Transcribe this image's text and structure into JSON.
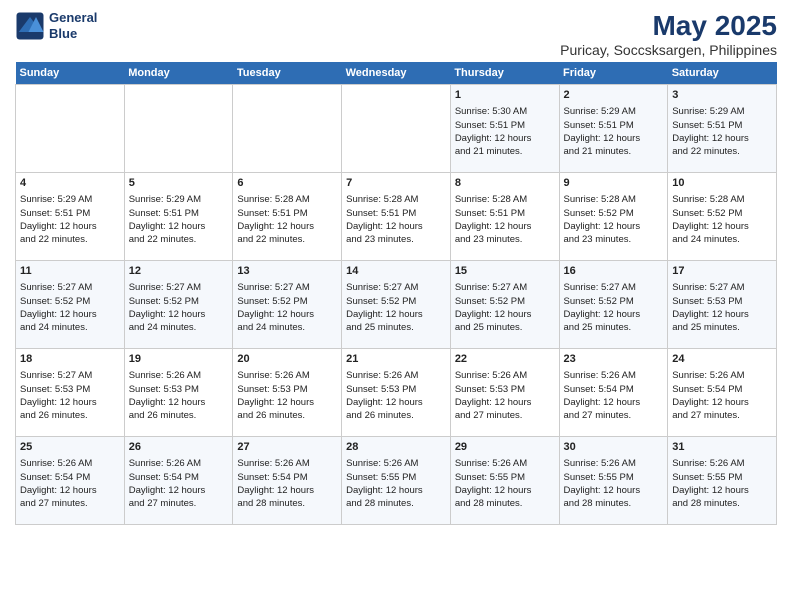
{
  "header": {
    "logo_line1": "General",
    "logo_line2": "Blue",
    "title": "May 2025",
    "subtitle": "Puricay, Soccsksargen, Philippines"
  },
  "days_of_week": [
    "Sunday",
    "Monday",
    "Tuesday",
    "Wednesday",
    "Thursday",
    "Friday",
    "Saturday"
  ],
  "weeks": [
    [
      {
        "day": "",
        "info": ""
      },
      {
        "day": "",
        "info": ""
      },
      {
        "day": "",
        "info": ""
      },
      {
        "day": "",
        "info": ""
      },
      {
        "day": "1",
        "info": "Sunrise: 5:30 AM\nSunset: 5:51 PM\nDaylight: 12 hours\nand 21 minutes."
      },
      {
        "day": "2",
        "info": "Sunrise: 5:29 AM\nSunset: 5:51 PM\nDaylight: 12 hours\nand 21 minutes."
      },
      {
        "day": "3",
        "info": "Sunrise: 5:29 AM\nSunset: 5:51 PM\nDaylight: 12 hours\nand 22 minutes."
      }
    ],
    [
      {
        "day": "4",
        "info": "Sunrise: 5:29 AM\nSunset: 5:51 PM\nDaylight: 12 hours\nand 22 minutes."
      },
      {
        "day": "5",
        "info": "Sunrise: 5:29 AM\nSunset: 5:51 PM\nDaylight: 12 hours\nand 22 minutes."
      },
      {
        "day": "6",
        "info": "Sunrise: 5:28 AM\nSunset: 5:51 PM\nDaylight: 12 hours\nand 22 minutes."
      },
      {
        "day": "7",
        "info": "Sunrise: 5:28 AM\nSunset: 5:51 PM\nDaylight: 12 hours\nand 23 minutes."
      },
      {
        "day": "8",
        "info": "Sunrise: 5:28 AM\nSunset: 5:51 PM\nDaylight: 12 hours\nand 23 minutes."
      },
      {
        "day": "9",
        "info": "Sunrise: 5:28 AM\nSunset: 5:52 PM\nDaylight: 12 hours\nand 23 minutes."
      },
      {
        "day": "10",
        "info": "Sunrise: 5:28 AM\nSunset: 5:52 PM\nDaylight: 12 hours\nand 24 minutes."
      }
    ],
    [
      {
        "day": "11",
        "info": "Sunrise: 5:27 AM\nSunset: 5:52 PM\nDaylight: 12 hours\nand 24 minutes."
      },
      {
        "day": "12",
        "info": "Sunrise: 5:27 AM\nSunset: 5:52 PM\nDaylight: 12 hours\nand 24 minutes."
      },
      {
        "day": "13",
        "info": "Sunrise: 5:27 AM\nSunset: 5:52 PM\nDaylight: 12 hours\nand 24 minutes."
      },
      {
        "day": "14",
        "info": "Sunrise: 5:27 AM\nSunset: 5:52 PM\nDaylight: 12 hours\nand 25 minutes."
      },
      {
        "day": "15",
        "info": "Sunrise: 5:27 AM\nSunset: 5:52 PM\nDaylight: 12 hours\nand 25 minutes."
      },
      {
        "day": "16",
        "info": "Sunrise: 5:27 AM\nSunset: 5:52 PM\nDaylight: 12 hours\nand 25 minutes."
      },
      {
        "day": "17",
        "info": "Sunrise: 5:27 AM\nSunset: 5:53 PM\nDaylight: 12 hours\nand 25 minutes."
      }
    ],
    [
      {
        "day": "18",
        "info": "Sunrise: 5:27 AM\nSunset: 5:53 PM\nDaylight: 12 hours\nand 26 minutes."
      },
      {
        "day": "19",
        "info": "Sunrise: 5:26 AM\nSunset: 5:53 PM\nDaylight: 12 hours\nand 26 minutes."
      },
      {
        "day": "20",
        "info": "Sunrise: 5:26 AM\nSunset: 5:53 PM\nDaylight: 12 hours\nand 26 minutes."
      },
      {
        "day": "21",
        "info": "Sunrise: 5:26 AM\nSunset: 5:53 PM\nDaylight: 12 hours\nand 26 minutes."
      },
      {
        "day": "22",
        "info": "Sunrise: 5:26 AM\nSunset: 5:53 PM\nDaylight: 12 hours\nand 27 minutes."
      },
      {
        "day": "23",
        "info": "Sunrise: 5:26 AM\nSunset: 5:54 PM\nDaylight: 12 hours\nand 27 minutes."
      },
      {
        "day": "24",
        "info": "Sunrise: 5:26 AM\nSunset: 5:54 PM\nDaylight: 12 hours\nand 27 minutes."
      }
    ],
    [
      {
        "day": "25",
        "info": "Sunrise: 5:26 AM\nSunset: 5:54 PM\nDaylight: 12 hours\nand 27 minutes."
      },
      {
        "day": "26",
        "info": "Sunrise: 5:26 AM\nSunset: 5:54 PM\nDaylight: 12 hours\nand 27 minutes."
      },
      {
        "day": "27",
        "info": "Sunrise: 5:26 AM\nSunset: 5:54 PM\nDaylight: 12 hours\nand 28 minutes."
      },
      {
        "day": "28",
        "info": "Sunrise: 5:26 AM\nSunset: 5:55 PM\nDaylight: 12 hours\nand 28 minutes."
      },
      {
        "day": "29",
        "info": "Sunrise: 5:26 AM\nSunset: 5:55 PM\nDaylight: 12 hours\nand 28 minutes."
      },
      {
        "day": "30",
        "info": "Sunrise: 5:26 AM\nSunset: 5:55 PM\nDaylight: 12 hours\nand 28 minutes."
      },
      {
        "day": "31",
        "info": "Sunrise: 5:26 AM\nSunset: 5:55 PM\nDaylight: 12 hours\nand 28 minutes."
      }
    ]
  ]
}
